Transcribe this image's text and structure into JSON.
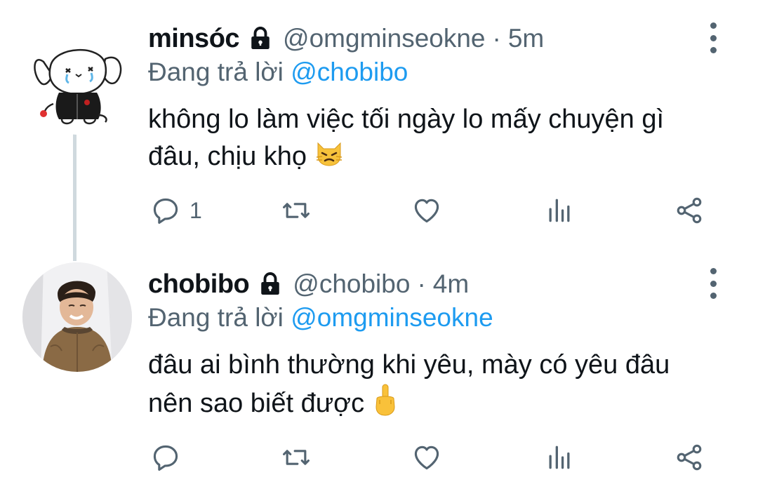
{
  "tweets": [
    {
      "name": "minsóc",
      "handle": "@omgminseokne",
      "separator": "·",
      "time": "5m",
      "replying_prefix": "Đang trả lời",
      "replying_to": "@chobibo",
      "text_line1": "không lo làm việc tối ngày lo mấy chuyện gì",
      "text_line2": "đâu, chịu khọ",
      "emoji": "angry-cat-emoji",
      "reply_count": "1",
      "icons": [
        "reply-icon",
        "retweet-icon",
        "like-icon",
        "views-icon",
        "share-icon"
      ]
    },
    {
      "name": "chobibo",
      "handle": "@chobibo",
      "separator": "·",
      "time": "4m",
      "replying_prefix": "Đang trả lời",
      "replying_to": "@omgminseokne",
      "text_line1": "đâu ai bình thường khi yêu, mày có yêu đâu",
      "text_line2": "nên sao biết được",
      "emoji": "middle-finger-emoji",
      "reply_count": "",
      "icons": [
        "reply-icon",
        "retweet-icon",
        "like-icon",
        "views-icon",
        "share-icon"
      ]
    }
  ],
  "colors": {
    "text": "#0f1419",
    "secondary": "#536471",
    "link": "#1d9bf0",
    "thread_line": "#cfd9de"
  }
}
